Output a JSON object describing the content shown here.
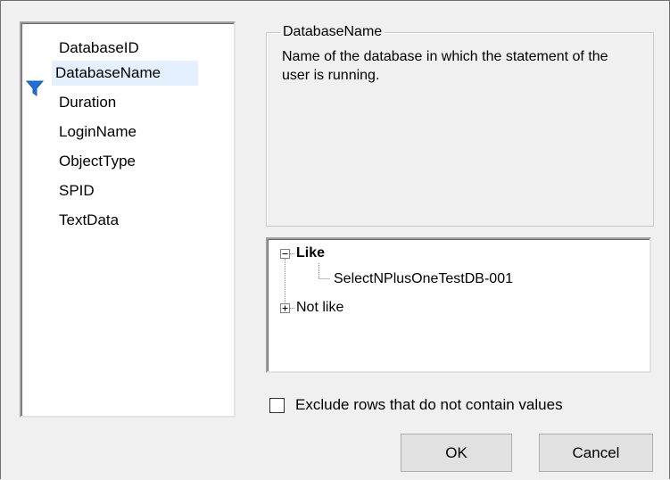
{
  "columns": {
    "items": [
      {
        "label": "DatabaseID"
      },
      {
        "label": "DatabaseName"
      },
      {
        "label": "Duration"
      },
      {
        "label": "LoginName"
      },
      {
        "label": "ObjectType"
      },
      {
        "label": "SPID"
      },
      {
        "label": "TextData"
      }
    ],
    "selected_index": 1,
    "filter_icon": "filter-funnel-icon",
    "filter_icon_color": "#1e6fd9"
  },
  "description": {
    "title": "DatabaseName",
    "text": "Name of the database in which the statement of the user is running."
  },
  "filter_tree": {
    "nodes": [
      {
        "label": "Like",
        "expanded": true,
        "bold": true,
        "children": [
          {
            "label": "SelectNPlusOneTestDB-001"
          }
        ]
      },
      {
        "label": "Not like",
        "expanded": false,
        "bold": false
      }
    ]
  },
  "exclude_checkbox": {
    "label": "Exclude rows that do not contain values",
    "checked": false
  },
  "buttons": {
    "ok": "OK",
    "cancel": "Cancel"
  }
}
